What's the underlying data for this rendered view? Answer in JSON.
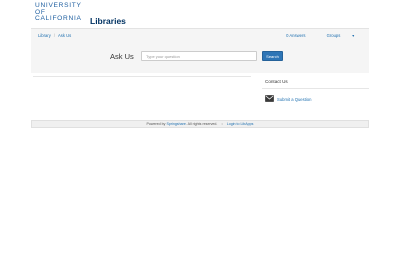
{
  "logo": {
    "university": "University\nof\nCalifornia",
    "libraries": "Libraries"
  },
  "navbar": {
    "breadcrumb": [
      "Library",
      "Ask Us"
    ],
    "answers": "0 Answers",
    "groups": "Groups"
  },
  "search": {
    "title": "Ask Us",
    "placeholder": "Type your question",
    "button": "Search"
  },
  "sidebar": {
    "title": "Contact Us",
    "submit": "Submit a Question"
  },
  "footer": {
    "powered_by": "Powered by",
    "vendor": "Springshare",
    "rights": ". All rights reserved.",
    "login": "Login to LibApps"
  },
  "colors": {
    "link": "#1f70b0",
    "brand_blue": "#003262",
    "button": "#2e75b6"
  }
}
